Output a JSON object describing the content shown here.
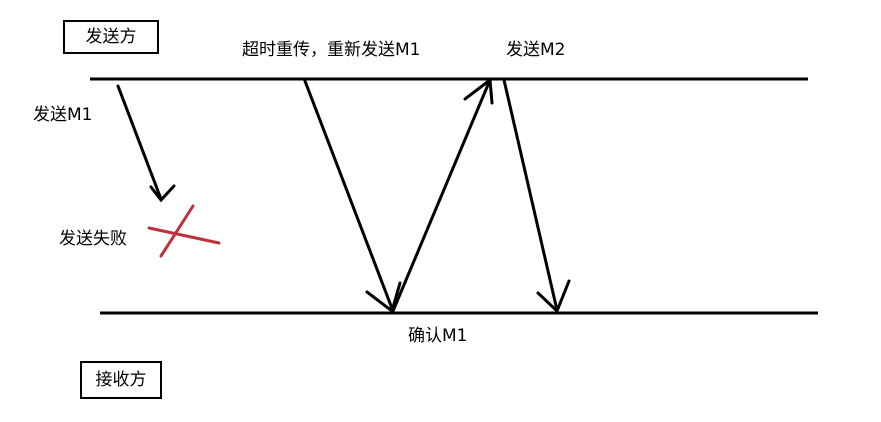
{
  "diagram": {
    "sender_label": "发送方",
    "receiver_label": "接收方",
    "send_m1_label": "发送M1",
    "retransmit_label": "超时重传，重新发送M1",
    "send_m2_label": "发送M2",
    "send_failed_label": "发送失败",
    "ack_m1_label": "确认M1"
  },
  "colors": {
    "line": "#000000",
    "failure_mark": "#c0303a",
    "background": "#ffffff"
  },
  "icons": {
    "failure_mark": "x-cross-icon"
  }
}
